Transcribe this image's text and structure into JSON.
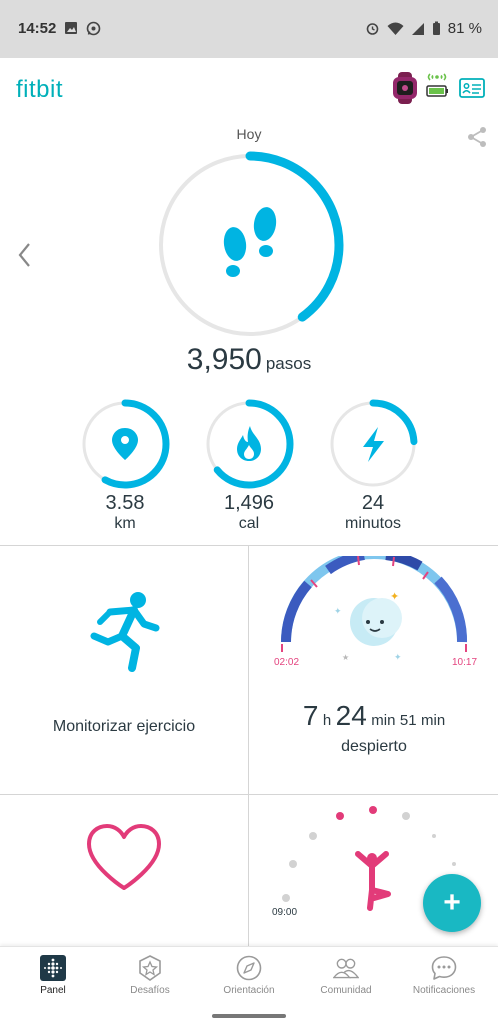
{
  "status_bar": {
    "time": "14:52",
    "battery": "81 %"
  },
  "app": {
    "logo": "fitbit"
  },
  "steps": {
    "day_label": "Hoy",
    "value": "3,950",
    "unit": "pasos",
    "progress": 0.4
  },
  "stats": [
    {
      "value": "3.58",
      "unit": "km",
      "icon": "location-pin-icon",
      "progress": 0.58
    },
    {
      "value": "1,496",
      "unit": "cal",
      "icon": "flame-icon",
      "progress": 0.64
    },
    {
      "value": "24",
      "unit": "minutos",
      "icon": "lightning-bolt-icon",
      "progress": 0.24
    }
  ],
  "exercise": {
    "label": "Monitorizar ejercicio"
  },
  "sleep": {
    "hours": "7",
    "hours_unit": "h",
    "minutes": "24",
    "minutes_unit": "min",
    "awake_minutes": "51",
    "awake_unit": "min",
    "label": "despierto",
    "start": "02:02",
    "end": "10:17"
  },
  "activity": {
    "time": "09:00"
  },
  "fab": {
    "label": "+"
  },
  "nav": [
    {
      "label": "Panel",
      "icon": "dashboard-icon",
      "active": true
    },
    {
      "label": "Desafíos",
      "icon": "badge-star-icon",
      "active": false
    },
    {
      "label": "Orientación",
      "icon": "compass-icon",
      "active": false
    },
    {
      "label": "Comunidad",
      "icon": "people-icon",
      "active": false
    },
    {
      "label": "Notificaciones",
      "icon": "chat-bubble-icon",
      "active": false
    }
  ],
  "colors": {
    "accent": "#00b0b9",
    "ring": "#00b4e2",
    "heart": "#e23b79",
    "sleep_dark": "#3b5bbf",
    "sleep_light": "#7ec6ee"
  }
}
